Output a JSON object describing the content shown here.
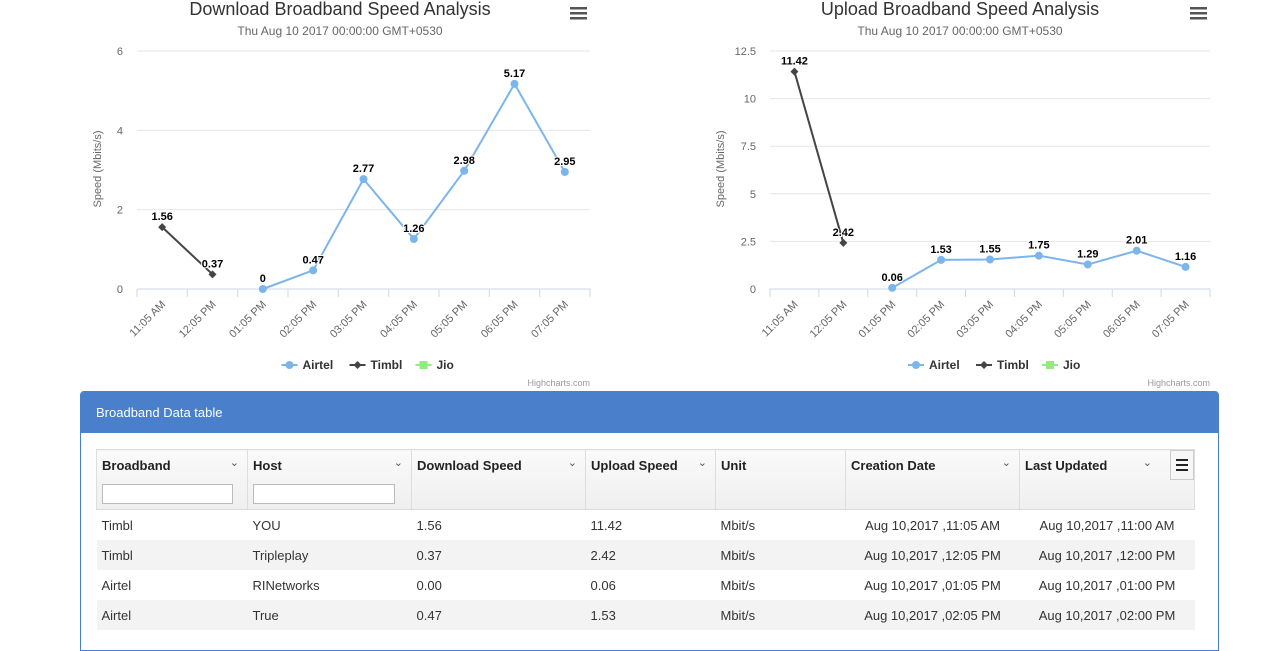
{
  "charts": {
    "download": {
      "title": "Download Broadband Speed Analysis",
      "subtitle": "Thu Aug 10 2017 00:00:00 GMT+0530",
      "ylabel": "Speed (Mbits/s)",
      "credits": "Highcharts.com"
    },
    "upload": {
      "title": "Upload Broadband Speed Analysis",
      "subtitle": "Thu Aug 10 2017 00:00:00 GMT+0530",
      "ylabel": "Speed (Mbits/s)",
      "credits": "Highcharts.com"
    }
  },
  "chart_data": [
    {
      "type": "line",
      "title": "Download Broadband Speed Analysis",
      "subtitle": "Thu Aug 10 2017 00:00:00 GMT+0530",
      "ylabel": "Speed (Mbits/s)",
      "categories": [
        "11:05 AM",
        "12:05 PM",
        "01:05 PM",
        "02:05 PM",
        "03:05 PM",
        "04:05 PM",
        "05:05 PM",
        "06:05 PM",
        "07:05 PM"
      ],
      "yticks": [
        "0",
        "2",
        "4",
        "6"
      ],
      "ylim": [
        0,
        6
      ],
      "grid": true,
      "legend": "bottom-center",
      "series": [
        {
          "name": "Airtel",
          "color": "#7cb5ec",
          "marker": "circle",
          "values": [
            null,
            null,
            0,
            0.47,
            2.77,
            1.26,
            2.98,
            5.17,
            2.95
          ],
          "labels": [
            null,
            null,
            "0",
            "0.47",
            "2.77",
            "1.26",
            "2.98",
            "5.17",
            "2.95"
          ]
        },
        {
          "name": "Timbl",
          "color": "#434348",
          "marker": "diamond",
          "values": [
            1.56,
            0.37,
            null,
            null,
            null,
            null,
            null,
            null,
            null
          ],
          "labels": [
            "1.56",
            "0.37",
            null,
            null,
            null,
            null,
            null,
            null,
            null
          ]
        },
        {
          "name": "Jio",
          "color": "#90ed7d",
          "marker": "square",
          "values": [
            null,
            null,
            null,
            null,
            null,
            null,
            null,
            null,
            null
          ],
          "labels": []
        }
      ]
    },
    {
      "type": "line",
      "title": "Upload Broadband Speed Analysis",
      "subtitle": "Thu Aug 10 2017 00:00:00 GMT+0530",
      "ylabel": "Speed (Mbits/s)",
      "categories": [
        "11:05 AM",
        "12:05 PM",
        "01:05 PM",
        "02:05 PM",
        "03:05 PM",
        "04:05 PM",
        "05:05 PM",
        "06:05 PM",
        "07:05 PM"
      ],
      "yticks": [
        "0",
        "2.5",
        "5",
        "7.5",
        "10",
        "12.5"
      ],
      "ylim": [
        0,
        12.5
      ],
      "grid": true,
      "legend": "bottom-center",
      "series": [
        {
          "name": "Airtel",
          "color": "#7cb5ec",
          "marker": "circle",
          "values": [
            null,
            null,
            0.06,
            1.53,
            1.55,
            1.75,
            1.29,
            2.01,
            1.16
          ],
          "labels": [
            null,
            null,
            "0.06",
            "1.53",
            "1.55",
            "1.75",
            "1.29",
            "2.01",
            "1.16"
          ]
        },
        {
          "name": "Timbl",
          "color": "#434348",
          "marker": "diamond",
          "values": [
            11.42,
            2.42,
            null,
            null,
            null,
            null,
            null,
            null,
            null
          ],
          "labels": [
            "11.42",
            "2.42",
            null,
            null,
            null,
            null,
            null,
            null,
            null
          ]
        },
        {
          "name": "Jio",
          "color": "#90ed7d",
          "marker": "square",
          "values": [
            null,
            null,
            null,
            null,
            null,
            null,
            null,
            null,
            null
          ],
          "labels": []
        }
      ]
    }
  ],
  "panel": {
    "title": "Broadband Data table"
  },
  "table": {
    "columns": [
      "Broadband",
      "Host",
      "Download Speed",
      "Upload Speed",
      "Unit",
      "Creation Date",
      "Last Updated"
    ],
    "rows": [
      [
        "Timbl",
        "YOU",
        "1.56",
        "11.42",
        "Mbit/s",
        "Aug 10,2017 ,11:05 AM",
        "Aug 10,2017 ,11:00 AM"
      ],
      [
        "Timbl",
        "Tripleplay",
        "0.37",
        "2.42",
        "Mbit/s",
        "Aug 10,2017 ,12:05 PM",
        "Aug 10,2017 ,12:00 PM"
      ],
      [
        "Airtel",
        "RINetworks",
        "0.00",
        "0.06",
        "Mbit/s",
        "Aug 10,2017 ,01:05 PM",
        "Aug 10,2017 ,01:00 PM"
      ],
      [
        "Airtel",
        "True",
        "0.47",
        "1.53",
        "Mbit/s",
        "Aug 10,2017 ,02:05 PM",
        "Aug 10,2017 ,02:00 PM"
      ]
    ],
    "filter_values": [
      "",
      ""
    ]
  },
  "icons": {
    "chart_menu": "hamburger-menu-icon",
    "column_menu": "chevron-down-icon",
    "grid_menu": "hamburger-menu-icon"
  }
}
